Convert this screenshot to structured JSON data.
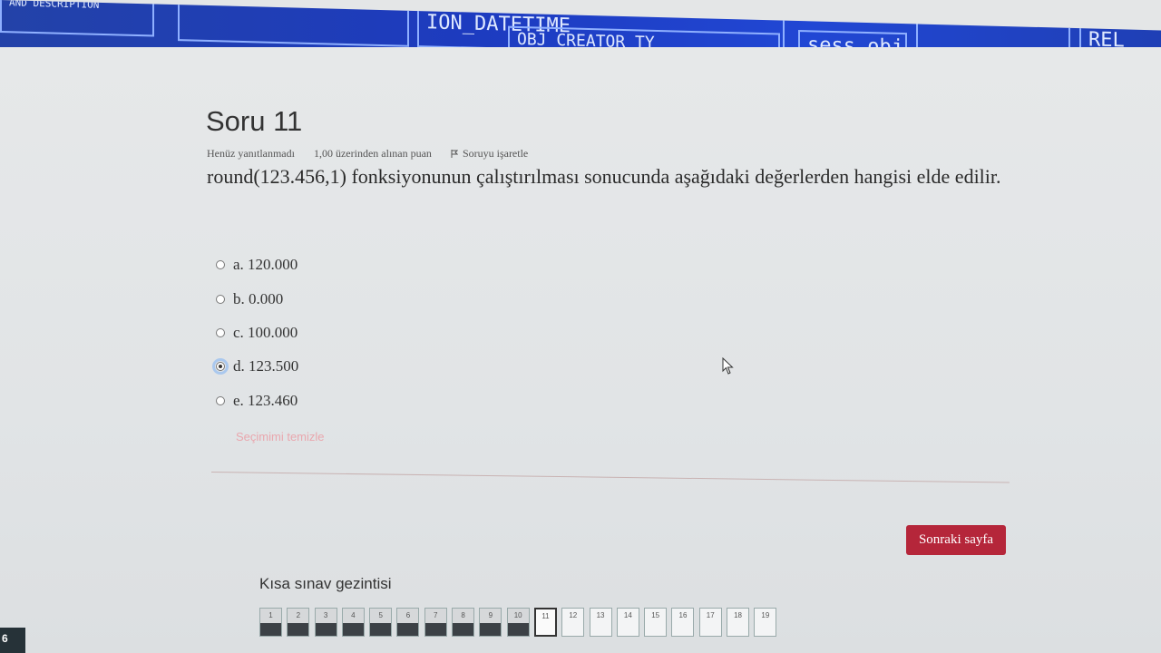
{
  "banner": {
    "text_1": "AND DESCRIPTION",
    "text_2": "ION_DATETIME",
    "text_3": "OBJ_CREATOR_TY",
    "text_4": "sess_obj",
    "text_5": "REL"
  },
  "question": {
    "title": "Soru 11",
    "status": "Henüz yanıtlanmadı",
    "marks": "1,00 üzerinden alınan puan",
    "flag_label": "Soruyu işaretle",
    "text": "round(123.456,1) fonksiyonunun çalıştırılması sonucunda aşağıdaki değerlerden hangisi elde edilir."
  },
  "answers": [
    {
      "label": "a. 120.000",
      "checked": false
    },
    {
      "label": "b. 0.000",
      "checked": false
    },
    {
      "label": "c. 100.000",
      "checked": false
    },
    {
      "label": "d. 123.500",
      "checked": true
    },
    {
      "label": "e. 123.460",
      "checked": false
    }
  ],
  "clear_choice": "Seçimimi temizle",
  "next_button": "Sonraki sayfa",
  "navigation": {
    "title": "Kısa sınav gezintisi",
    "current": 11,
    "items": [
      {
        "label": "1",
        "state": "answered"
      },
      {
        "label": "2",
        "state": "answered"
      },
      {
        "label": "3",
        "state": "answered"
      },
      {
        "label": "4",
        "state": "answered"
      },
      {
        "label": "5",
        "state": "answered"
      },
      {
        "label": "6",
        "state": "answered"
      },
      {
        "label": "7",
        "state": "answered"
      },
      {
        "label": "8",
        "state": "answered"
      },
      {
        "label": "9",
        "state": "answered"
      },
      {
        "label": "10",
        "state": "answered"
      },
      {
        "label": "11",
        "state": "current"
      },
      {
        "label": "12",
        "state": "unanswered"
      },
      {
        "label": "13",
        "state": "unanswered"
      },
      {
        "label": "14",
        "state": "unanswered"
      },
      {
        "label": "15",
        "state": "unanswered"
      },
      {
        "label": "16",
        "state": "unanswered"
      },
      {
        "label": "17",
        "state": "unanswered"
      },
      {
        "label": "18",
        "state": "unanswered"
      },
      {
        "label": "19",
        "state": "unanswered"
      }
    ]
  },
  "corner_badge": "6",
  "colors": {
    "accent": "#b5263a",
    "clear_link": "#e9a7ae",
    "banner": "#1d3bbf"
  }
}
